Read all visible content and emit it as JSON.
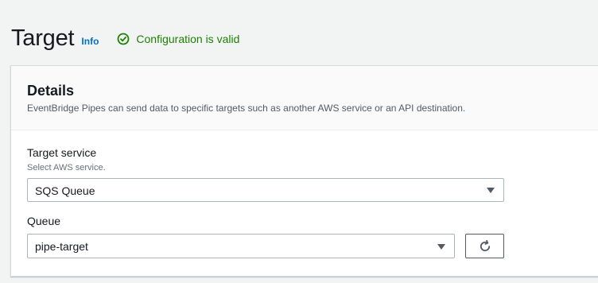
{
  "header": {
    "title": "Target",
    "info_label": "Info",
    "status_text": "Configuration is valid",
    "status_color": "#1d8102",
    "status_icon": "check-circle-icon"
  },
  "details": {
    "title": "Details",
    "description": "EventBridge Pipes can send data to specific targets such as another AWS service or an API destination."
  },
  "target_service": {
    "label": "Target service",
    "hint": "Select AWS service.",
    "value": "SQS Queue",
    "icon": "caret-down-icon"
  },
  "queue": {
    "label": "Queue",
    "value": "pipe-target",
    "icon": "caret-down-icon",
    "refresh_icon": "refresh-icon"
  },
  "colors": {
    "link": "#0073bb",
    "background": "#f2f3f3",
    "border": "#aab7b8"
  }
}
